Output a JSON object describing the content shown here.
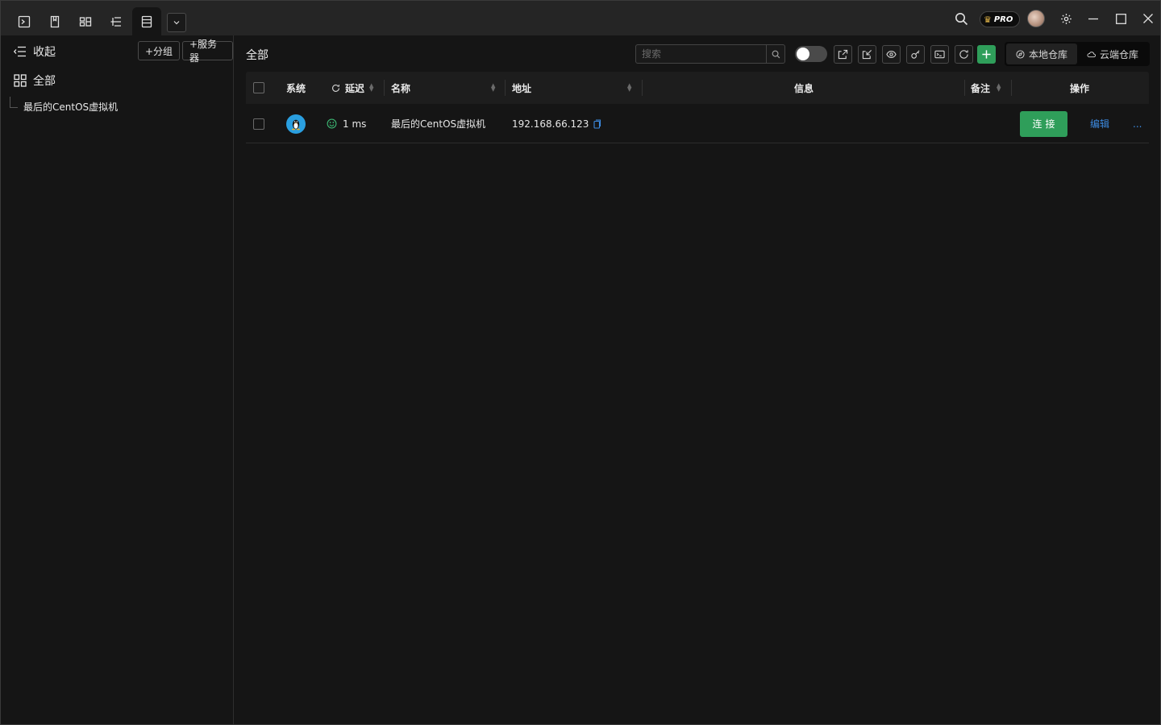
{
  "titlebar": {
    "tabs": [
      {
        "icon": "terminal-icon"
      },
      {
        "icon": "bookmark-icon"
      },
      {
        "icon": "layout-icon"
      },
      {
        "icon": "tree-icon"
      },
      {
        "icon": "server-list-icon",
        "active": true
      }
    ],
    "pro_label": "PRO"
  },
  "sidebar": {
    "collapse_label": "收起",
    "add_group_label": "+分组",
    "add_server_label": "+服务器",
    "all_label": "全部",
    "items": [
      {
        "label": "最后的CentOS虚拟机"
      }
    ]
  },
  "main": {
    "title": "全部",
    "search_placeholder": "搜索",
    "repo": {
      "local": "本地仓库",
      "cloud": "云端仓库",
      "active": "local"
    }
  },
  "table": {
    "headers": {
      "system": "系统",
      "latency": "延迟",
      "name": "名称",
      "address": "地址",
      "info": "信息",
      "remark": "备注",
      "actions": "操作"
    },
    "rows": [
      {
        "os": "linux",
        "latency": "1 ms",
        "name": "最后的CentOS虚拟机",
        "address": "192.168.66.123",
        "info": "",
        "remark": "",
        "connect_label": "连接",
        "edit_label": "编辑",
        "more_label": "..."
      }
    ]
  },
  "colors": {
    "accent_green": "#2f9e5a",
    "link_blue": "#3c8ae0",
    "background": "#151515"
  }
}
